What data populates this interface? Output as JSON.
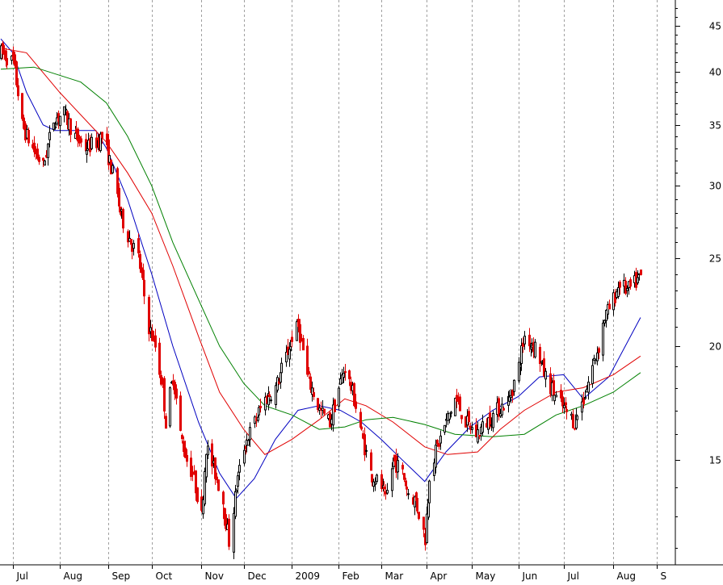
{
  "chart_data": {
    "type": "candlestick",
    "title": "",
    "xlabel": "",
    "ylabel": "",
    "y_scale": "log",
    "ylim": [
      11.5,
      48
    ],
    "grid": "vertical dotted",
    "colors": {
      "up_candle": "#000000",
      "down_candle": "#e00000",
      "ma_short": "#0000c0",
      "ma_mid": "#e00000",
      "ma_long": "#008000",
      "grid": "#a0a0a0",
      "background": "#ffffff"
    },
    "y_ticks": [
      {
        "value": 15,
        "label": "15"
      },
      {
        "value": 20,
        "label": "20"
      },
      {
        "value": 25,
        "label": "25"
      },
      {
        "value": 30,
        "label": "30"
      },
      {
        "value": 35,
        "label": "35"
      },
      {
        "value": 40,
        "label": "40"
      },
      {
        "value": 45,
        "label": "45"
      }
    ],
    "x_ticks": [
      {
        "label": "Jul",
        "date": "2008-07-01"
      },
      {
        "label": "Aug",
        "date": "2008-08-01"
      },
      {
        "label": "Sep",
        "date": "2008-09-02"
      },
      {
        "label": "Oct",
        "date": "2008-10-01"
      },
      {
        "label": "Nov",
        "date": "2008-11-03"
      },
      {
        "label": "Dec",
        "date": "2008-12-01"
      },
      {
        "label": "2009",
        "date": "2009-01-02"
      },
      {
        "label": "Feb",
        "date": "2009-02-02"
      },
      {
        "label": "Mar",
        "date": "2009-03-02"
      },
      {
        "label": "Apr",
        "date": "2009-04-01"
      },
      {
        "label": "May",
        "date": "2009-05-01"
      },
      {
        "label": "Jun",
        "date": "2009-06-01"
      },
      {
        "label": "Jul",
        "date": "2009-07-01"
      },
      {
        "label": "Aug",
        "date": "2009-08-03"
      },
      {
        "label": "S",
        "date": "2009-09-01"
      }
    ],
    "price_path": [
      [
        "2008-06-23",
        42.0
      ],
      [
        "2008-07-01",
        41.0
      ],
      [
        "2008-07-07",
        35.0
      ],
      [
        "2008-07-10",
        34.0
      ],
      [
        "2008-07-16",
        32.5
      ],
      [
        "2008-07-21",
        31.5
      ],
      [
        "2008-07-28",
        35.5
      ],
      [
        "2008-08-04",
        36.0
      ],
      [
        "2008-08-11",
        34.0
      ],
      [
        "2008-08-18",
        33.0
      ],
      [
        "2008-08-25",
        33.5
      ],
      [
        "2008-08-29",
        34.0
      ],
      [
        "2008-09-05",
        31.0
      ],
      [
        "2008-09-10",
        28.0
      ],
      [
        "2008-09-15",
        26.5
      ],
      [
        "2008-09-22",
        25.0
      ],
      [
        "2008-09-29",
        21.0
      ],
      [
        "2008-10-03",
        20.0
      ],
      [
        "2008-10-08",
        18.0
      ],
      [
        "2008-10-10",
        16.5
      ],
      [
        "2008-10-15",
        18.5
      ],
      [
        "2008-10-20",
        16.0
      ],
      [
        "2008-10-24",
        15.0
      ],
      [
        "2008-10-28",
        14.5
      ],
      [
        "2008-11-03",
        13.0
      ],
      [
        "2008-11-06",
        15.5
      ],
      [
        "2008-11-12",
        14.5
      ],
      [
        "2008-11-17",
        13.5
      ],
      [
        "2008-11-21",
        12.2
      ],
      [
        "2008-11-26",
        14.0
      ],
      [
        "2008-12-01",
        15.5
      ],
      [
        "2008-12-08",
        16.5
      ],
      [
        "2008-12-15",
        17.5
      ],
      [
        "2008-12-22",
        18.0
      ],
      [
        "2008-12-29",
        19.5
      ],
      [
        "2009-01-02",
        20.5
      ],
      [
        "2009-01-06",
        21.0
      ],
      [
        "2009-01-12",
        18.5
      ],
      [
        "2009-01-20",
        17.0
      ],
      [
        "2009-01-27",
        16.5
      ],
      [
        "2009-02-02",
        18.0
      ],
      [
        "2009-02-06",
        19.0
      ],
      [
        "2009-02-12",
        17.5
      ],
      [
        "2009-02-17",
        16.0
      ],
      [
        "2009-02-23",
        14.5
      ],
      [
        "2009-03-02",
        14.0
      ],
      [
        "2009-03-05",
        13.5
      ],
      [
        "2009-03-10",
        15.0
      ],
      [
        "2009-03-16",
        14.5
      ],
      [
        "2009-03-20",
        13.8
      ],
      [
        "2009-03-25",
        13.5
      ],
      [
        "2009-03-31",
        12.3
      ],
      [
        "2009-04-03",
        14.5
      ],
      [
        "2009-04-08",
        15.5
      ],
      [
        "2009-04-14",
        16.5
      ],
      [
        "2009-04-20",
        17.5
      ],
      [
        "2009-04-27",
        16.5
      ],
      [
        "2009-05-04",
        16.0
      ],
      [
        "2009-05-11",
        16.5
      ],
      [
        "2009-05-18",
        17.0
      ],
      [
        "2009-05-26",
        17.5
      ],
      [
        "2009-06-01",
        19.0
      ],
      [
        "2009-06-05",
        20.5
      ],
      [
        "2009-06-12",
        20.0
      ],
      [
        "2009-06-19",
        18.5
      ],
      [
        "2009-06-26",
        17.5
      ],
      [
        "2009-07-02",
        17.0
      ],
      [
        "2009-07-08",
        16.5
      ],
      [
        "2009-07-14",
        17.5
      ],
      [
        "2009-07-20",
        19.0
      ],
      [
        "2009-07-24",
        20.0
      ],
      [
        "2009-07-28",
        21.5
      ],
      [
        "2009-08-03",
        22.5
      ],
      [
        "2009-08-07",
        23.5
      ],
      [
        "2009-08-12",
        23.0
      ],
      [
        "2009-08-18",
        23.5
      ],
      [
        "2009-08-21",
        23.8
      ]
    ],
    "series": [
      {
        "values": [
          [
            "2008-06-23",
            43.5
          ],
          [
            "2008-07-01",
            42.0
          ],
          [
            "2008-07-10",
            38.0
          ],
          [
            "2008-07-21",
            35.0
          ],
          [
            "2008-07-29",
            34.5
          ],
          [
            "2008-08-11",
            34.5
          ],
          [
            "2008-08-25",
            34.5
          ],
          [
            "2008-09-01",
            33.0
          ],
          [
            "2008-09-15",
            29.0
          ],
          [
            "2008-10-01",
            24.0
          ],
          [
            "2008-10-15",
            20.0
          ],
          [
            "2008-11-01",
            16.5
          ],
          [
            "2008-11-15",
            14.5
          ],
          [
            "2008-11-26",
            13.6
          ],
          [
            "2008-12-08",
            14.3
          ],
          [
            "2008-12-22",
            15.8
          ],
          [
            "2009-01-06",
            17.0
          ],
          [
            "2009-01-20",
            17.2
          ],
          [
            "2009-02-03",
            17.0
          ],
          [
            "2009-02-17",
            16.5
          ],
          [
            "2009-03-02",
            15.8
          ],
          [
            "2009-03-16",
            15.0
          ],
          [
            "2009-03-31",
            14.2
          ],
          [
            "2009-04-14",
            15.3
          ],
          [
            "2009-04-30",
            16.3
          ],
          [
            "2009-05-15",
            17.0
          ],
          [
            "2009-06-01",
            17.6
          ],
          [
            "2009-06-15",
            18.5
          ],
          [
            "2009-07-01",
            18.6
          ],
          [
            "2009-07-14",
            17.5
          ],
          [
            "2009-07-31",
            18.5
          ],
          [
            "2009-08-21",
            21.5
          ]
        ]
      },
      {
        "values": [
          [
            "2008-06-23",
            42.5
          ],
          [
            "2008-07-10",
            42.0
          ],
          [
            "2008-08-01",
            38.0
          ],
          [
            "2008-09-01",
            33.5
          ],
          [
            "2008-09-15",
            31.0
          ],
          [
            "2008-10-01",
            28.0
          ],
          [
            "2008-10-15",
            24.5
          ],
          [
            "2008-11-01",
            20.5
          ],
          [
            "2008-11-15",
            17.8
          ],
          [
            "2008-12-01",
            16.2
          ],
          [
            "2008-12-15",
            15.2
          ],
          [
            "2009-01-02",
            15.8
          ],
          [
            "2009-01-20",
            16.6
          ],
          [
            "2009-02-06",
            17.5
          ],
          [
            "2009-02-20",
            17.2
          ],
          [
            "2009-03-10",
            16.5
          ],
          [
            "2009-03-31",
            15.5
          ],
          [
            "2009-04-15",
            15.2
          ],
          [
            "2009-05-05",
            15.3
          ],
          [
            "2009-05-20",
            16.2
          ],
          [
            "2009-06-05",
            17.0
          ],
          [
            "2009-06-26",
            17.8
          ],
          [
            "2009-07-14",
            18.0
          ],
          [
            "2009-08-03",
            18.6
          ],
          [
            "2009-08-21",
            19.5
          ]
        ]
      },
      {
        "values": [
          [
            "2008-06-23",
            40.3
          ],
          [
            "2008-07-15",
            40.5
          ],
          [
            "2008-08-15",
            39.0
          ],
          [
            "2008-09-01",
            37.0
          ],
          [
            "2008-09-15",
            34.0
          ],
          [
            "2008-10-01",
            30.0
          ],
          [
            "2008-10-15",
            26.0
          ],
          [
            "2008-11-01",
            22.5
          ],
          [
            "2008-11-15",
            20.0
          ],
          [
            "2008-12-01",
            18.2
          ],
          [
            "2008-12-15",
            17.2
          ],
          [
            "2009-01-02",
            16.8
          ],
          [
            "2009-01-20",
            16.2
          ],
          [
            "2009-02-06",
            16.3
          ],
          [
            "2009-02-20",
            16.6
          ],
          [
            "2009-03-10",
            16.7
          ],
          [
            "2009-03-31",
            16.4
          ],
          [
            "2009-04-20",
            16.0
          ],
          [
            "2009-05-15",
            15.9
          ],
          [
            "2009-06-05",
            16.0
          ],
          [
            "2009-06-26",
            16.8
          ],
          [
            "2009-07-14",
            17.2
          ],
          [
            "2009-08-03",
            17.8
          ],
          [
            "2009-08-21",
            18.7
          ]
        ]
      }
    ]
  }
}
